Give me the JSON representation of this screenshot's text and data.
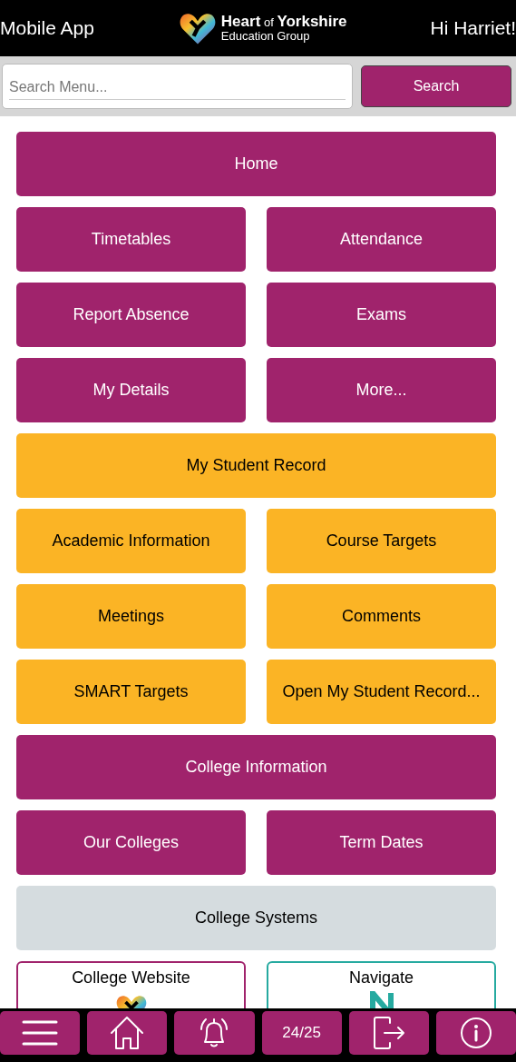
{
  "header": {
    "left": "Mobile App",
    "logo": {
      "title": "**Heart** of **Yorkshire**",
      "subtitle": "Education Group"
    },
    "right": "Hi Harriet!"
  },
  "search": {
    "placeholder": "Search Menu...",
    "button": "Search"
  },
  "tiles": [
    {
      "label": "Home",
      "kind": "full",
      "color": "#a0236c"
    },
    {
      "label": "Timetables",
      "kind": "half",
      "color": "#a0236c"
    },
    {
      "label": "Attendance",
      "kind": "half",
      "color": "#a0236c"
    },
    {
      "label": "Report Absence",
      "kind": "half",
      "color": "#a0236c"
    },
    {
      "label": "Exams",
      "kind": "half",
      "color": "#a0236c"
    },
    {
      "label": "My Details",
      "kind": "half",
      "color": "#a0236c"
    },
    {
      "label": "More...",
      "kind": "half",
      "color": "#a0236c"
    },
    {
      "label": "My Student Record",
      "kind": "full",
      "color": "#fbb425"
    },
    {
      "label": "Academic Information",
      "kind": "half",
      "color": "#fbb425"
    },
    {
      "label": "Course Targets",
      "kind": "half",
      "color": "#fbb425"
    },
    {
      "label": "Meetings",
      "kind": "half",
      "color": "#fbb425"
    },
    {
      "label": "Comments",
      "kind": "half",
      "color": "#fbb425"
    },
    {
      "label": "SMART Targets",
      "kind": "half",
      "color": "#fbb425"
    },
    {
      "label": "Open My Student Record...",
      "kind": "half",
      "color": "#fbb425"
    },
    {
      "label": "College Information",
      "kind": "full",
      "color": "#a0236c"
    },
    {
      "label": "Our Colleges",
      "kind": "half",
      "color": "#a0236c"
    },
    {
      "label": "Term Dates",
      "kind": "half",
      "color": "#a0236c"
    },
    {
      "label": "College Systems",
      "kind": "full",
      "color": "#d5dcdf"
    }
  ],
  "links": [
    {
      "label": "College Website",
      "kind": "heart",
      "color": "#a0236c"
    },
    {
      "label": "Navigate",
      "kind": "letter",
      "color": "#26aaa0"
    }
  ],
  "nav": [
    {
      "kind": "menu"
    },
    {
      "kind": "home"
    },
    {
      "kind": "bell"
    },
    {
      "kind": "text",
      "label": "24/25"
    },
    {
      "kind": "logout"
    },
    {
      "kind": "info"
    }
  ]
}
